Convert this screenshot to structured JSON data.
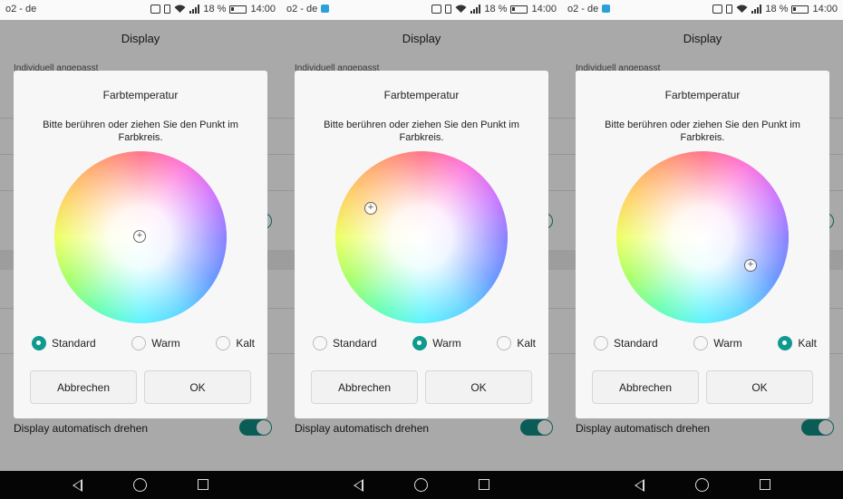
{
  "status": {
    "carrier": "o2 - de",
    "battery": "18 %",
    "time": "14:00"
  },
  "page": {
    "title": "Display",
    "section": "Individuell angepasst",
    "auto_rotate": "Display automatisch drehen"
  },
  "dialog": {
    "title": "Farbtemperatur",
    "message": "Bitte berühren oder ziehen Sie den Punkt im Farbkreis.",
    "options": [
      "Standard",
      "Warm",
      "Kalt"
    ],
    "cancel": "Abbrechen",
    "ok": "OK"
  },
  "panels": [
    {
      "selected": "Standard",
      "marker_icon": "plus-icon",
      "has_notification": false
    },
    {
      "selected": "Warm",
      "marker_icon": "plus-icon",
      "has_notification": true
    },
    {
      "selected": "Kalt",
      "marker_icon": "plus-icon",
      "has_notification": true
    }
  ],
  "colors": {
    "accent": "#0f9a8f",
    "toggle": "#0f8a80"
  }
}
